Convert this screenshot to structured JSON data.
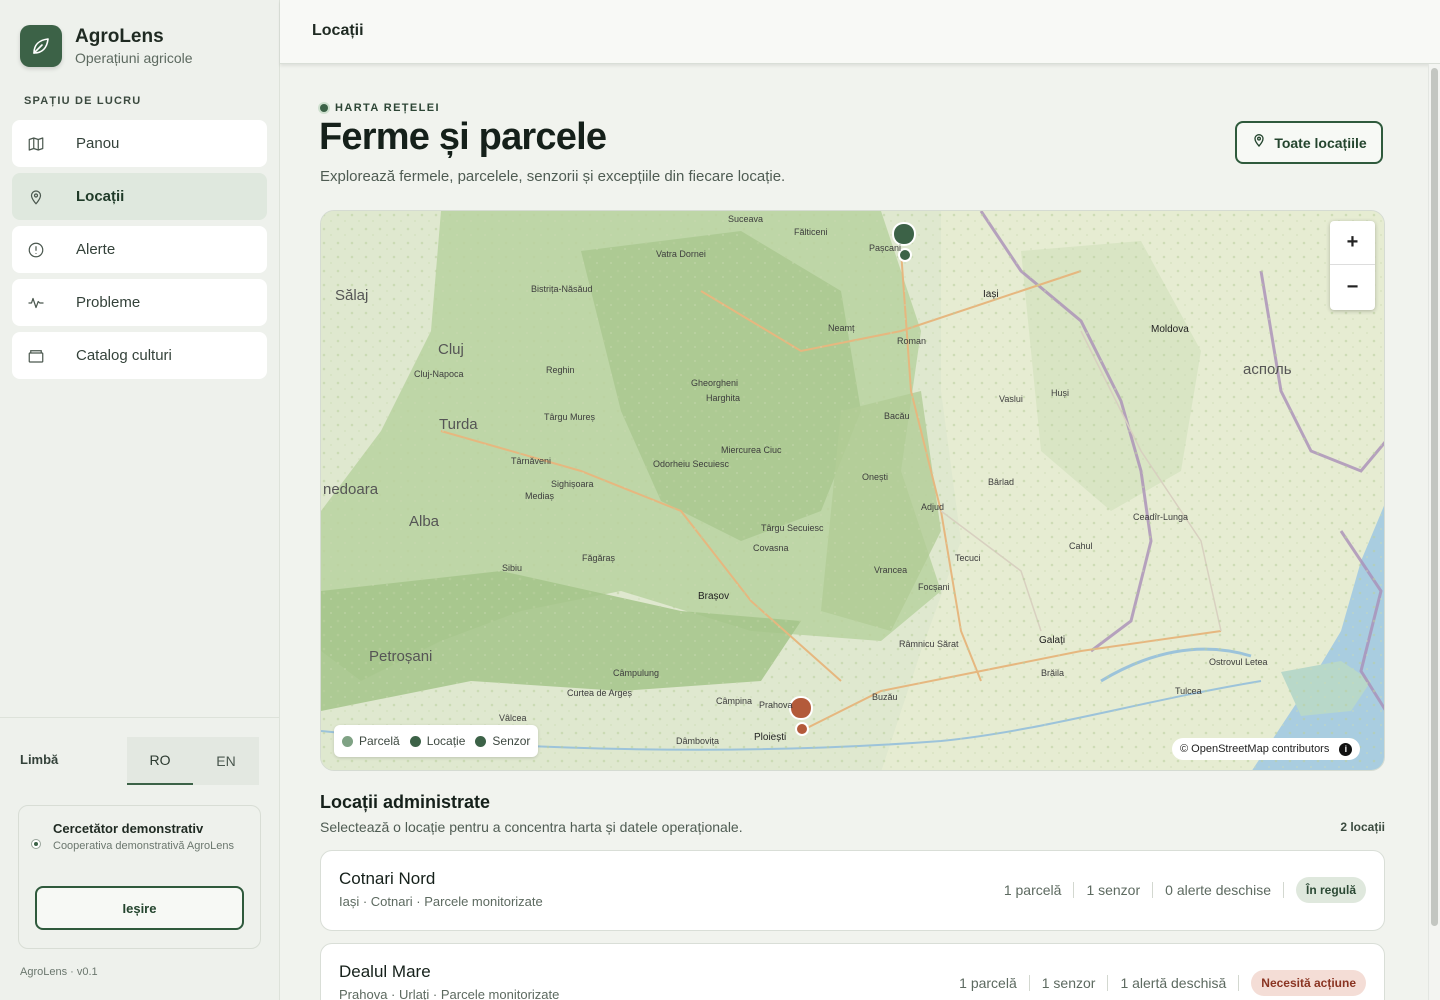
{
  "sidebar": {
    "brand_name": "AgroLens",
    "brand_subtitle": "Operațiuni agricole",
    "workspace_label": "SPAȚIU DE LUCRU",
    "items": [
      {
        "label": "Panou",
        "icon": "map-icon"
      },
      {
        "label": "Locații",
        "icon": "pin-icon",
        "active": true
      },
      {
        "label": "Alerte",
        "icon": "alert-circle-icon"
      },
      {
        "label": "Probleme",
        "icon": "pulse-icon"
      },
      {
        "label": "Catalog culturi",
        "icon": "archive-icon"
      }
    ],
    "language_label": "Limbă",
    "languages": [
      "RO",
      "EN"
    ],
    "active_language": "RO",
    "user": {
      "name": "Cercetător demonstrativ",
      "org": "Cooperativa demonstrativă AgroLens",
      "logout_label": "Ieșire"
    },
    "version": "AgroLens · v0.1"
  },
  "topbar": {
    "title": "Locații"
  },
  "header": {
    "eyebrow": "HARTA REȚELEI",
    "title": "Ferme și parcele",
    "subtitle": "Explorează fermele, parcelele, senzorii și excepțiile din fiecare locație.",
    "all_locations_button": "Toate locațiile"
  },
  "map": {
    "legend": [
      {
        "label": "Parcelă",
        "color": "#7fa284"
      },
      {
        "label": "Locație",
        "color": "#3c6247"
      },
      {
        "label": "Senzor",
        "color": "#3c6247"
      }
    ],
    "attribution": "© OpenStreetMap contributors",
    "zoom_in": "+",
    "zoom_out": "−",
    "labels": {
      "salaj": "Sălaj",
      "cluj": "Cluj",
      "cluj_napoca": "Cluj-Napoca",
      "turda": "Turda",
      "alba": "Alba",
      "hunedoara": "nedoara",
      "petrosani": "Petroșani",
      "brasov": "Brașov",
      "ploiesti": "Ploiești",
      "iasi": "Iași",
      "galati": "Galați",
      "moldova": "Moldova",
      "tiraspol": "асполь",
      "vatra_dornei": "Vatra Dornei",
      "suceava": "Suceava",
      "falticeni": "Fălticeni",
      "pascani": "Pașcani",
      "roman": "Roman",
      "bacau": "Bacău",
      "onesti": "Onești",
      "adjud": "Adjud",
      "focsani": "Focșani",
      "barlad": "Bârlad",
      "vaslui": "Vaslui",
      "husi": "Huși",
      "cahul": "Cahul",
      "tecuci": "Tecuci",
      "buzau": "Buzău",
      "campina": "Câmpina",
      "sighisoara": "Sighișoara",
      "medias": "Mediaș",
      "sibiu": "Sibiu",
      "fagaras": "Făgăraș",
      "tg_mures": "Târgu Mureș",
      "tg_secuiesc": "Târgu Secuiesc",
      "miercurea_ciuc": "Miercurea Ciuc",
      "odorheiu": "Odorheiu Secuiesc",
      "gheorgheni": "Gheorgheni",
      "reghin": "Reghin",
      "campulung": "Câmpulung",
      "curtea": "Curtea de Argeș",
      "rm_sarat": "Râmnicu Sărat",
      "tulcea": "Tulcea",
      "bistrita": "Bistrița-Năsăud",
      "harghita": "Harghita",
      "covasna": "Covasna",
      "vrancea": "Vrancea",
      "prahova": "Prahova",
      "dambovita": "Dâmbovița",
      "valcea": "Vâlcea",
      "neamt": "Neamț",
      "tarnaveni": "Târnăveni",
      "braila": "Brăila",
      "ceadir": "Ceadîr-Lunga",
      "ostrovul": "Ostrovul Letea"
    }
  },
  "locations": {
    "title": "Locații administrate",
    "subtitle": "Selectează o locație pentru a concentra harta și datele operaționale.",
    "count": "2 locații",
    "items": [
      {
        "name": "Cotnari Nord",
        "meta": "Iași · Cotnari · Parcele monitorizate",
        "parcels": "1 parcelă",
        "sensors": "1 senzor",
        "alerts": "0 alerte deschise",
        "status": "În regulă",
        "status_kind": "ok"
      },
      {
        "name": "Dealul Mare",
        "meta": "Prahova · Urlați · Parcele monitorizate",
        "parcels": "1 parcelă",
        "sensors": "1 senzor",
        "alerts": "1 alertă deschisă",
        "status": "Necesită acțiune",
        "status_kind": "warn"
      }
    ]
  },
  "colors": {
    "accent": "#3c6247",
    "warning": "#b35a3a",
    "ok_badge": "#dfe8dd",
    "warn_badge": "#f4ddd6"
  }
}
